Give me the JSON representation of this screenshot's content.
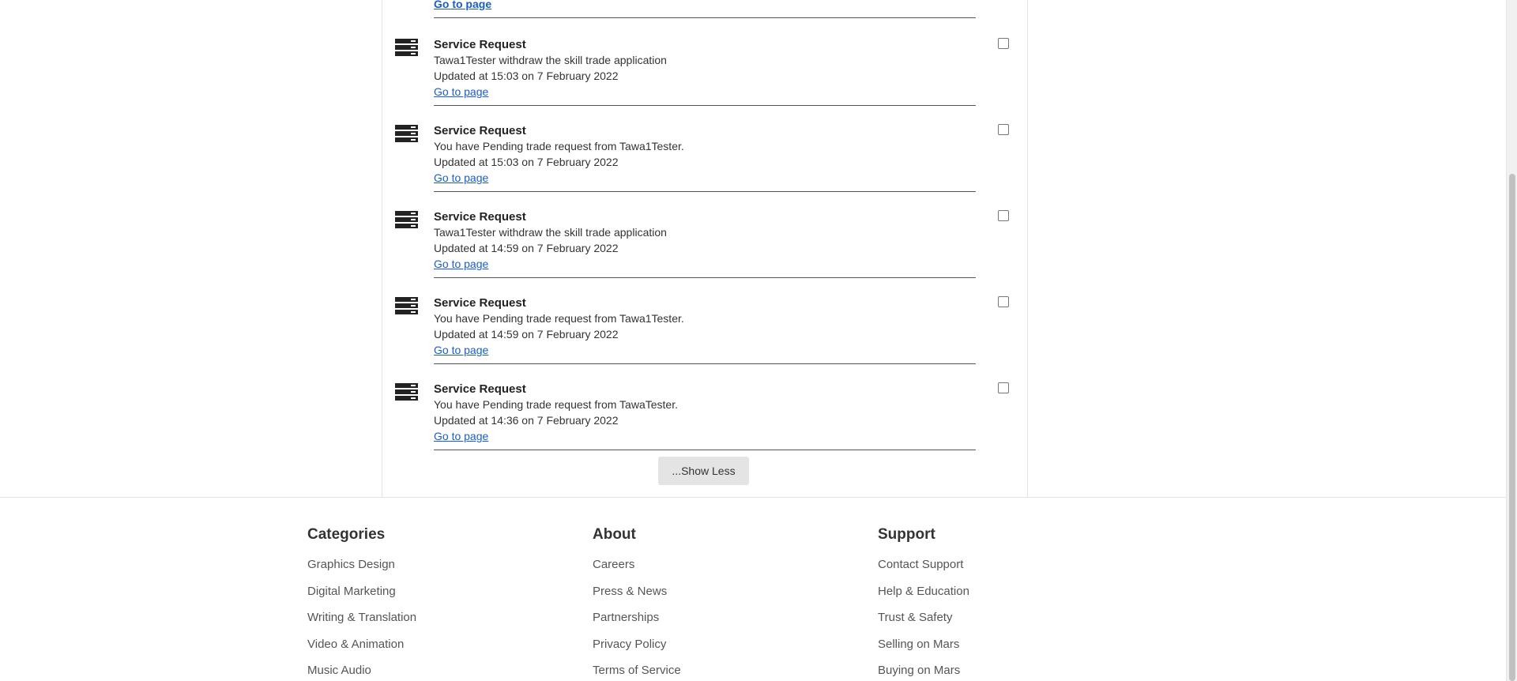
{
  "top": {
    "link": "Go to page"
  },
  "notifications": [
    {
      "title": "Service Request",
      "message": "Tawa1Tester withdraw the skill trade application",
      "updated": "Updated at 15:03 on 7 February 2022",
      "link": "Go to page"
    },
    {
      "title": "Service Request",
      "message": "You have Pending trade request from Tawa1Tester.",
      "updated": "Updated at 15:03 on 7 February 2022",
      "link": "Go to page"
    },
    {
      "title": "Service Request",
      "message": "Tawa1Tester withdraw the skill trade application",
      "updated": "Updated at 14:59 on 7 February 2022",
      "link": "Go to page"
    },
    {
      "title": "Service Request",
      "message": "You have Pending trade request from Tawa1Tester.",
      "updated": "Updated at 14:59 on 7 February 2022",
      "link": "Go to page"
    },
    {
      "title": "Service Request",
      "message": "You have Pending trade request from TawaTester.",
      "updated": "Updated at 14:36 on 7 February 2022",
      "link": "Go to page"
    }
  ],
  "show_less": "...Show Less",
  "footer": {
    "categories": {
      "heading": "Categories",
      "items": [
        "Graphics Design",
        "Digital Marketing",
        "Writing & Translation",
        "Video & Animation",
        "Music Audio"
      ]
    },
    "about": {
      "heading": "About",
      "items": [
        "Careers",
        "Press & News",
        "Partnerships",
        "Privacy Policy",
        "Terms of Service"
      ]
    },
    "support": {
      "heading": "Support",
      "items": [
        "Contact Support",
        "Help & Education",
        "Trust & Safety",
        "Selling on Mars",
        "Buying on Mars"
      ]
    }
  },
  "icons": {
    "notification": "server-rack-icon"
  },
  "colors": {
    "link": "#1a5dc8",
    "text": "#333333",
    "button_bg": "#e4e4e4"
  }
}
